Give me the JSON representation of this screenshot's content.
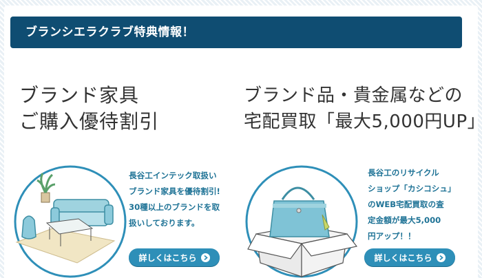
{
  "banner": {
    "title": "ブランシエラクラブ特典情報！"
  },
  "offers": [
    {
      "headline_line1": "ブランド家具",
      "headline_line2": "ご購入優待割引",
      "description": "長谷工インテック取扱い\nブランド家具を優待割引!\n30種以上のブランドを取\n扱いしております。",
      "button_label": "詳しくはこちら",
      "illustration_icon": "furniture-illustration-icon"
    },
    {
      "headline_line1": "ブランド品・貴金属などの",
      "headline_line2": "宅配買取「最大5,000円UP」",
      "description": "長谷工のリサイクル\nショップ「カシコシュ」\nのWEB宅配買取の査\n定金額が最大5,000\n円アップ！！",
      "button_label": "詳しくはこちら",
      "illustration_icon": "handbag-box-illustration-icon"
    }
  ],
  "colors": {
    "banner": "#0f4d72",
    "button": "#2e8fb8",
    "description_text": "#1f7396",
    "headline_text": "#333333"
  }
}
